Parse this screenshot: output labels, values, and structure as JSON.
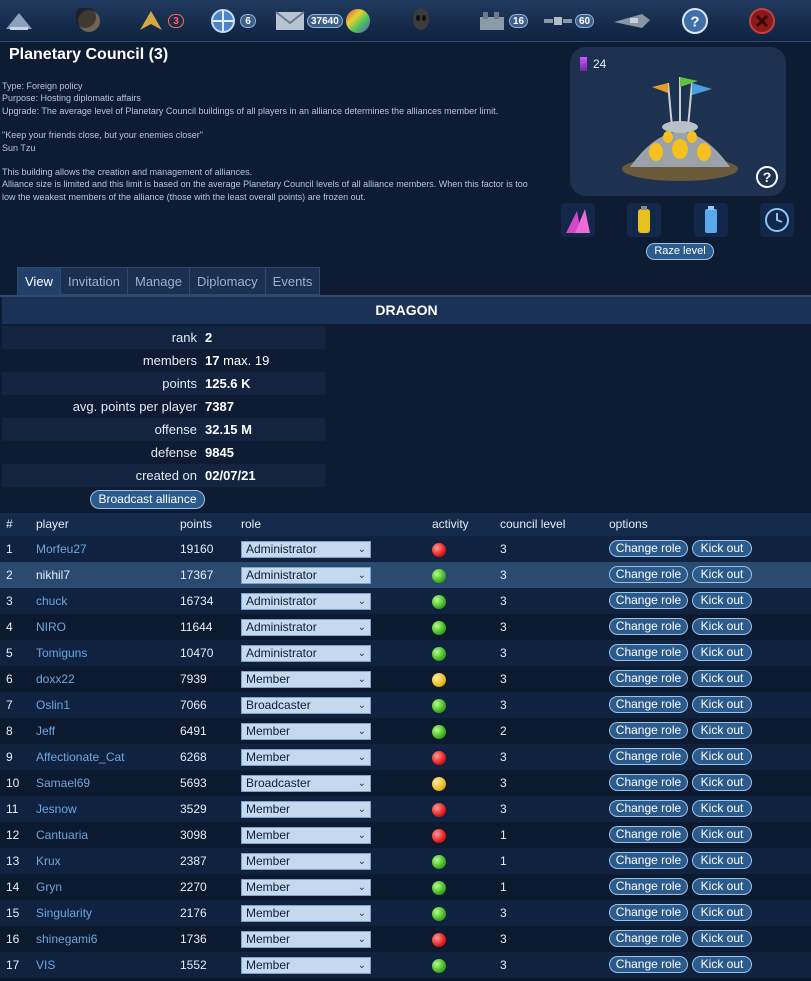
{
  "topbar": {
    "items": [
      {
        "icon": "ship-icon"
      },
      {
        "icon": "planet-icon"
      },
      {
        "icon": "fleet-alert-icon",
        "badge": "3",
        "badge_style": "red"
      },
      {
        "icon": "radar-icon",
        "badge": "6"
      },
      {
        "icon": "mail-icon",
        "badge": "37640"
      },
      {
        "icon": "color-orb-icon"
      },
      {
        "icon": "alien-head-icon"
      },
      {
        "icon": "factory-icon",
        "badge": "16"
      },
      {
        "icon": "satellite-icon",
        "badge": "60"
      },
      {
        "icon": "cruiser-icon"
      },
      {
        "icon": "help-icon"
      },
      {
        "icon": "close-icon"
      }
    ]
  },
  "building": {
    "title": "Planetary Council (3)",
    "type": "Type: Foreign policy",
    "purpose": "Purpose: Hosting diplomatic affairs",
    "upgrade": "Upgrade: The average level of Planetary Council buildings of all players in an alliance determines the alliances member limit.",
    "quote": "\"Keep your friends close, but your enemies closer\"",
    "quote_author": "Sun Tzu",
    "desc1": "This building allows the creation and management of alliances.",
    "desc2": "Alliance size is limited and this limit is based on the average Planetary Council levels of all alliance members. When this factor is too low the weakest members of the alliance (those with the least overall points) are frozen out.",
    "level_count": "24",
    "raze_label": "Raze level"
  },
  "tabs": [
    "View",
    "Invitation",
    "Manage",
    "Diplomacy",
    "Events"
  ],
  "alliance": {
    "name": "DRAGON",
    "rank_label": "rank",
    "rank": "2",
    "members_label": "members",
    "members": "17",
    "members_max": "max. 19",
    "points_label": "points",
    "points": "125.6 K",
    "avg_label": "avg. points per player",
    "avg": "7387",
    "offense_label": "offense",
    "offense": "32.15 M",
    "defense_label": "defense",
    "defense": "9845",
    "created_label": "created on",
    "created": "02/07/21",
    "broadcast_label": "Broadcast alliance"
  },
  "members_table": {
    "headers": {
      "num": "#",
      "player": "player",
      "points": "points",
      "role": "role",
      "activity": "activity",
      "council": "council level",
      "options": "options"
    },
    "change_role_label": "Change role",
    "kick_label": "Kick out",
    "rows": [
      {
        "num": "1",
        "player": "Morfeu27",
        "points": "19160",
        "role": "Administrator",
        "activity": "red",
        "council": "3"
      },
      {
        "num": "2",
        "player": "nikhil7",
        "points": "17367",
        "role": "Administrator",
        "activity": "green",
        "council": "3"
      },
      {
        "num": "3",
        "player": "chuck",
        "points": "16734",
        "role": "Administrator",
        "activity": "green",
        "council": "3"
      },
      {
        "num": "4",
        "player": "NIRO",
        "points": "11644",
        "role": "Administrator",
        "activity": "green",
        "council": "3"
      },
      {
        "num": "5",
        "player": "Tomiguns",
        "points": "10470",
        "role": "Administrator",
        "activity": "green",
        "council": "3"
      },
      {
        "num": "6",
        "player": "doxx22",
        "points": "7939",
        "role": "Member",
        "activity": "yellow",
        "council": "3"
      },
      {
        "num": "7",
        "player": "Oslin1",
        "points": "7066",
        "role": "Broadcaster",
        "activity": "green",
        "council": "3"
      },
      {
        "num": "8",
        "player": "Jeff",
        "points": "6491",
        "role": "Member",
        "activity": "green",
        "council": "2"
      },
      {
        "num": "9",
        "player": "Affectionate_Cat",
        "points": "6268",
        "role": "Member",
        "activity": "red",
        "council": "3"
      },
      {
        "num": "10",
        "player": "Samael69",
        "points": "5693",
        "role": "Broadcaster",
        "activity": "yellow",
        "council": "3"
      },
      {
        "num": "11",
        "player": "Jesnow",
        "points": "3529",
        "role": "Member",
        "activity": "red",
        "council": "3"
      },
      {
        "num": "12",
        "player": "Cantuaria",
        "points": "3098",
        "role": "Member",
        "activity": "red",
        "council": "1"
      },
      {
        "num": "13",
        "player": "Krux",
        "points": "2387",
        "role": "Member",
        "activity": "green",
        "council": "1"
      },
      {
        "num": "14",
        "player": "Gryn",
        "points": "2270",
        "role": "Member",
        "activity": "green",
        "council": "1"
      },
      {
        "num": "15",
        "player": "Singularity",
        "points": "2176",
        "role": "Member",
        "activity": "green",
        "council": "3"
      },
      {
        "num": "16",
        "player": "shinegami6",
        "points": "1736",
        "role": "Member",
        "activity": "red",
        "council": "3"
      },
      {
        "num": "17",
        "player": "VIS",
        "points": "1552",
        "role": "Member",
        "activity": "green",
        "council": "3"
      }
    ]
  },
  "colors": {
    "background": "#0d1c33",
    "accent": "#2b5a8c",
    "link": "#6ea6dd",
    "highlight_row": "#2b4a70"
  }
}
